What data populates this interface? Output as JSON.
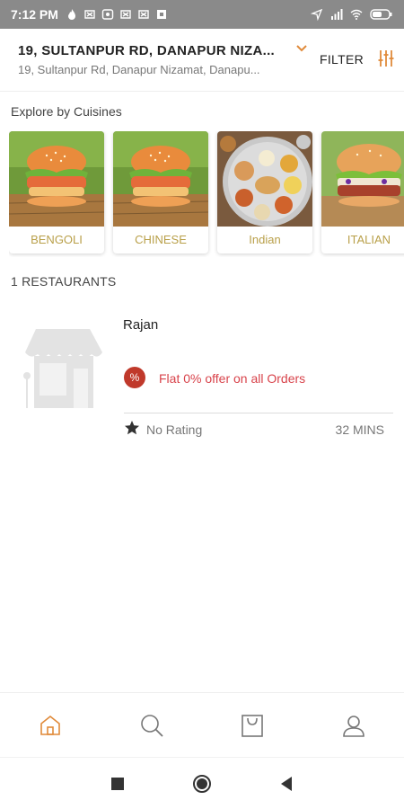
{
  "status_bar": {
    "time": "7:12 PM",
    "left_icons": [
      "flame-icon",
      "notification-icon",
      "notification-icon",
      "notification-icon",
      "notification-icon",
      "notification-icon"
    ],
    "right_icons": [
      "location-arrow-icon",
      "signal-icon",
      "wifi-icon",
      "battery-icon"
    ]
  },
  "header": {
    "address_title": "19, SULTANPUR RD, DANAPUR NIZA...",
    "address_subtitle": "19, Sultanpur Rd, Danapur Nizamat, Danapu...",
    "filter_label": "FILTER",
    "accent_color": "#e08a3a"
  },
  "cuisines": {
    "title": "Explore by Cuisines",
    "items": [
      {
        "label": "BENGOLI",
        "image": "burger-image"
      },
      {
        "label": "CHINESE",
        "image": "burger-image"
      },
      {
        "label": "Indian",
        "image": "thali-image"
      },
      {
        "label": "ITALIAN",
        "image": "burger-image"
      }
    ],
    "label_color": "#b9a04a"
  },
  "restaurants": {
    "count_label": "1 RESTAURANTS",
    "items": [
      {
        "name": "Rajan",
        "offer_badge": "%",
        "offer_text": "Flat 0% offer on all Orders",
        "rating": "No Rating",
        "eta": "32 MINS"
      }
    ]
  },
  "bottom_nav": {
    "items": [
      "home-icon",
      "search-icon",
      "bag-icon",
      "profile-icon"
    ],
    "active_color": "#e08a3a"
  },
  "android_nav": {
    "items": [
      "recents-icon",
      "home-button-icon",
      "back-icon"
    ]
  }
}
